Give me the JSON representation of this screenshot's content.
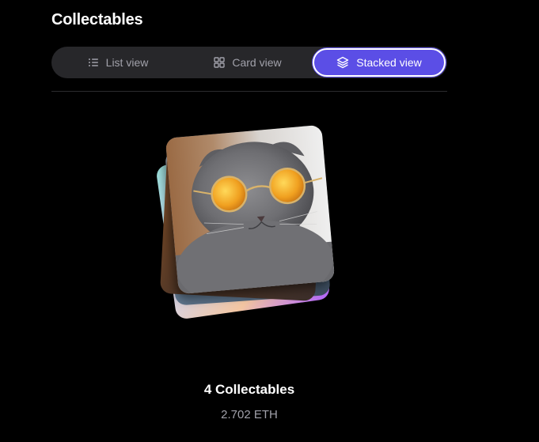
{
  "page": {
    "title": "Collectables"
  },
  "view_toggle": {
    "options": [
      {
        "label": "List view",
        "icon": "list-icon",
        "active": false
      },
      {
        "label": "Card view",
        "icon": "grid-icon",
        "active": false
      },
      {
        "label": "Stacked view",
        "icon": "layers-icon",
        "active": true
      }
    ]
  },
  "collection": {
    "count_label": "4 Collectables",
    "total_value": "2.702 ETH",
    "cards": [
      {
        "image": "cat-with-sunglasses"
      },
      {
        "image": "brown-abstract"
      },
      {
        "image": "blue-abstract"
      },
      {
        "image": "iridescent-gradient"
      }
    ]
  },
  "colors": {
    "background": "#000000",
    "segment_bg": "#27272a",
    "accent": "#5b4ee6",
    "muted_text": "#a1a1aa"
  }
}
